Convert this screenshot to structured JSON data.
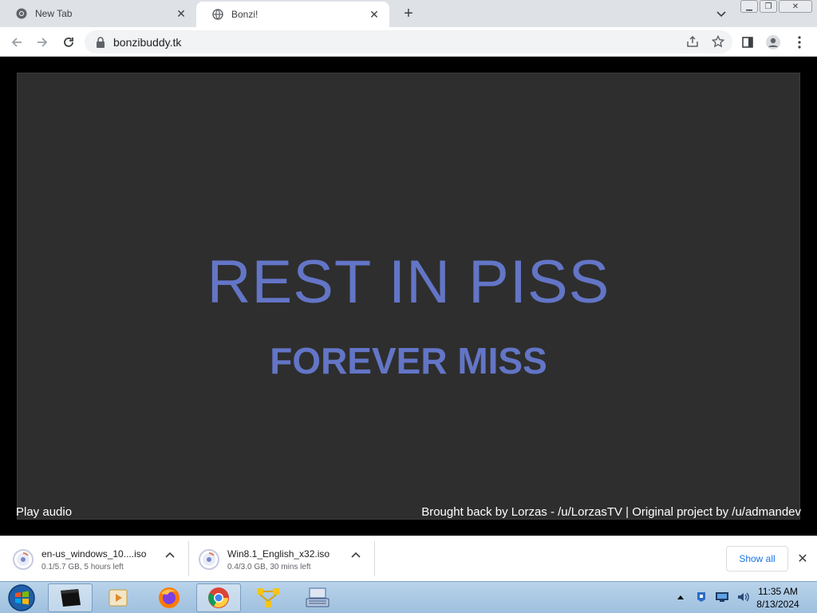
{
  "browser": {
    "tabs": [
      {
        "title": "New Tab",
        "active": false
      },
      {
        "title": "Bonzi!",
        "active": true
      }
    ],
    "url": "bonzibuddy.tk"
  },
  "page": {
    "headline": "REST IN PISS",
    "subheadline": "FOREVER MISS",
    "play_audio": "Play audio",
    "credits": "Brought back by Lorzas - /u/LorzasTV | Original project by /u/admandev",
    "headline_color": "#6375c6",
    "stage_color": "#2e2e2e"
  },
  "downloads": {
    "items": [
      {
        "name": "en-us_windows_10....iso",
        "status": "0.1/5.7 GB, 5 hours left"
      },
      {
        "name": "Win8.1_English_x32.iso",
        "status": "0.4/3.0 GB, 30 mins left"
      }
    ],
    "show_all": "Show all"
  },
  "taskbar": {
    "apps": [
      "terminal-app",
      "media-player-app",
      "firefox-app",
      "chrome-app",
      "network-app",
      "keyboard-app"
    ],
    "active_app": "chrome-app",
    "time": "11:35 AM",
    "date": "8/13/2024"
  }
}
